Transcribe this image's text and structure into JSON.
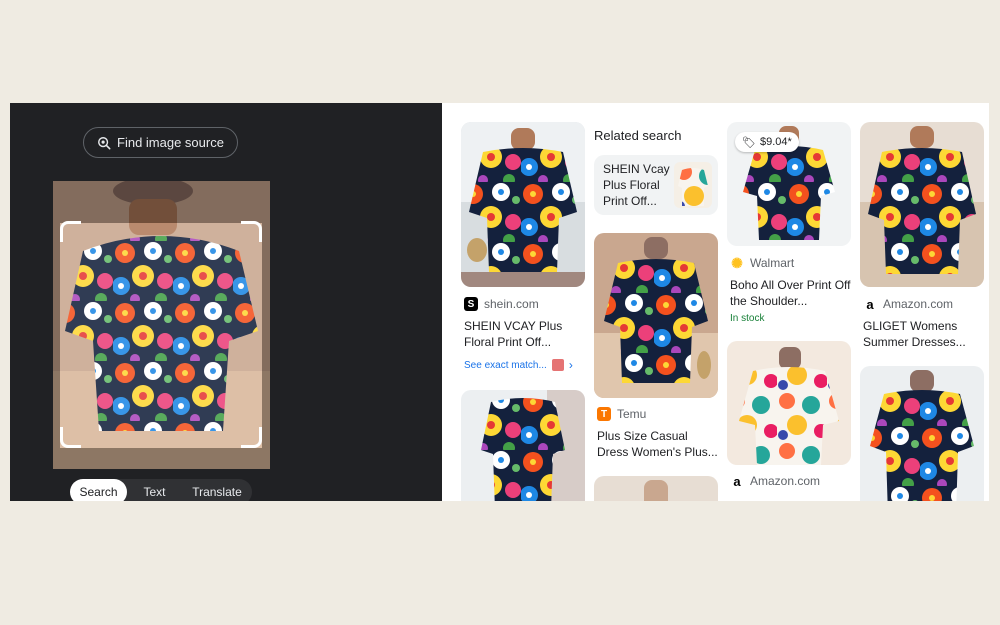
{
  "left_panel": {
    "find_source_label": "Find image source",
    "tabs": [
      {
        "label": "Search",
        "active": true
      },
      {
        "label": "Text",
        "active": false
      },
      {
        "label": "Translate",
        "active": false
      }
    ]
  },
  "results": {
    "related_search_heading": "Related search",
    "related_search_item": "SHEIN Vcay Plus Floral Print Off...",
    "items": [
      {
        "source": "shein.com",
        "title": "SHEIN VCAY Plus Floral Print Off...",
        "see_exact_match": "See exact match..."
      },
      {
        "source": "Temu",
        "title": "Plus Size Casual Dress Women's Plus..."
      },
      {
        "source": "Walmart",
        "title": "Boho All Over Print Off the Shoulder...",
        "price": "$9.04*",
        "stock": "In stock"
      },
      {
        "source": "Amazon.com",
        "title": ""
      },
      {
        "source": "Amazon.com",
        "title": "GLIGET Womens Summer Dresses..."
      }
    ]
  },
  "colors": {
    "page_background": "#efebe2",
    "dark_panel": "#202124",
    "link_blue": "#1a73e8",
    "stock_green": "#188038"
  }
}
